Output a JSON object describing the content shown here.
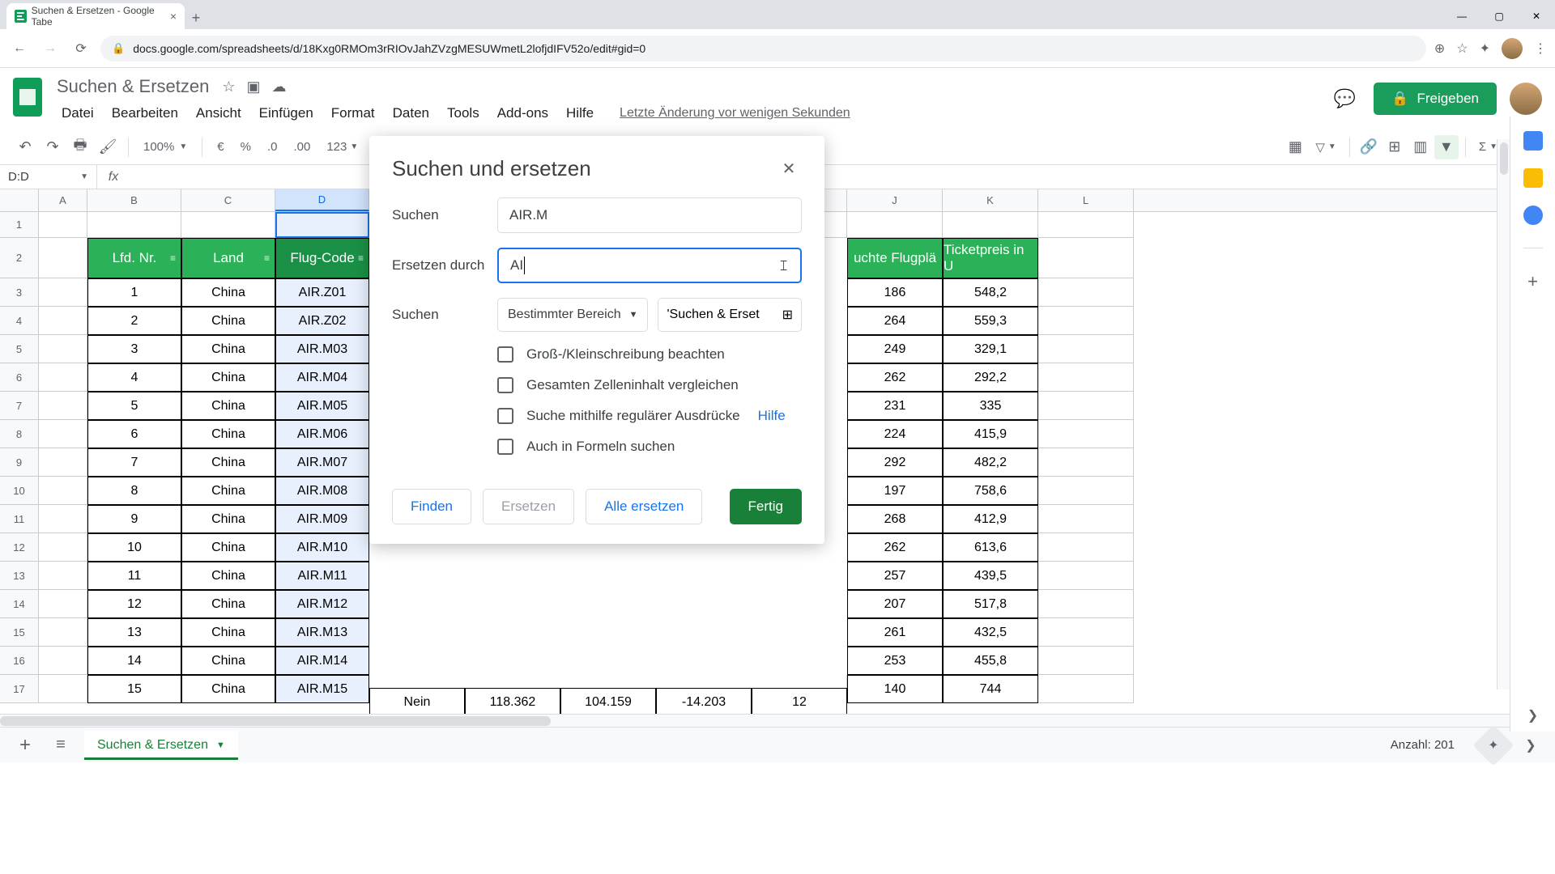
{
  "browser": {
    "tab_title": "Suchen & Ersetzen - Google Tabe",
    "url": "docs.google.com/spreadsheets/d/18Kxg0RMOm3rRIOvJahZVzgMESUWmetL2lofjdIFV52o/edit#gid=0"
  },
  "doc": {
    "title": "Suchen & Ersetzen",
    "menus": [
      "Datei",
      "Bearbeiten",
      "Ansicht",
      "Einfügen",
      "Format",
      "Daten",
      "Tools",
      "Add-ons",
      "Hilfe"
    ],
    "last_edit": "Letzte Änderung vor wenigen Sekunden",
    "share": "Freigeben"
  },
  "toolbar": {
    "zoom": "100%",
    "currency": "€",
    "percent": "%",
    "dec_dec": ".0",
    "inc_dec": ".00",
    "num_format": "123",
    "sigma": "Σ"
  },
  "formula_bar": {
    "name_box": "D:D",
    "fx": "fx"
  },
  "columns": [
    "A",
    "B",
    "C",
    "D",
    "J",
    "K",
    "L"
  ],
  "table": {
    "headers": {
      "B": "Lfd. Nr.",
      "C": "Land",
      "D": "Flug-Code",
      "J": "uchte Flugplä",
      "K": "Ticketpreis in U"
    },
    "rows": [
      {
        "n": 1,
        "B": "1",
        "C": "China",
        "D": "AIR.Z01",
        "J": "186",
        "K": "548,2"
      },
      {
        "n": 2,
        "B": "2",
        "C": "China",
        "D": "AIR.Z02",
        "J": "264",
        "K": "559,3"
      },
      {
        "n": 3,
        "B": "3",
        "C": "China",
        "D": "AIR.M03",
        "J": "249",
        "K": "329,1"
      },
      {
        "n": 4,
        "B": "4",
        "C": "China",
        "D": "AIR.M04",
        "J": "262",
        "K": "292,2"
      },
      {
        "n": 5,
        "B": "5",
        "C": "China",
        "D": "AIR.M05",
        "J": "231",
        "K": "335"
      },
      {
        "n": 6,
        "B": "6",
        "C": "China",
        "D": "AIR.M06",
        "J": "224",
        "K": "415,9"
      },
      {
        "n": 7,
        "B": "7",
        "C": "China",
        "D": "AIR.M07",
        "J": "292",
        "K": "482,2"
      },
      {
        "n": 8,
        "B": "8",
        "C": "China",
        "D": "AIR.M08",
        "J": "197",
        "K": "758,6"
      },
      {
        "n": 9,
        "B": "9",
        "C": "China",
        "D": "AIR.M09",
        "J": "268",
        "K": "412,9"
      },
      {
        "n": 10,
        "B": "10",
        "C": "China",
        "D": "AIR.M10",
        "J": "262",
        "K": "613,6"
      },
      {
        "n": 11,
        "B": "11",
        "C": "China",
        "D": "AIR.M11",
        "J": "257",
        "K": "439,5"
      },
      {
        "n": 12,
        "B": "12",
        "C": "China",
        "D": "AIR.M12",
        "J": "207",
        "K": "517,8"
      },
      {
        "n": 13,
        "B": "13",
        "C": "China",
        "D": "AIR.M13",
        "J": "261",
        "K": "432,5"
      },
      {
        "n": 14,
        "B": "14",
        "C": "China",
        "D": "AIR.M14",
        "J": "253",
        "K": "455,8"
      },
      {
        "n": 15,
        "B": "15",
        "C": "China",
        "D": "AIR.M15",
        "J": "140",
        "K": "744"
      }
    ],
    "row17_mid": [
      "Nein",
      "118.362",
      "104.159",
      "-14.203",
      "12"
    ]
  },
  "dialog": {
    "title": "Suchen und ersetzen",
    "search_label": "Suchen",
    "search_value": "AIR.M",
    "replace_label": "Ersetzen durch",
    "replace_value": "AI",
    "scope_label": "Suchen",
    "scope_value": "Bestimmter Bereich",
    "range_value": "'Suchen & Erset",
    "opt_case": "Groß-/Kleinschreibung beachten",
    "opt_entire": "Gesamten Zelleninhalt vergleichen",
    "opt_regex": "Suche mithilfe regulärer Ausdrücke",
    "opt_regex_help": "Hilfe",
    "opt_formulas": "Auch in Formeln suchen",
    "btn_find": "Finden",
    "btn_replace": "Ersetzen",
    "btn_replace_all": "Alle ersetzen",
    "btn_done": "Fertig"
  },
  "sheet_tabs": {
    "active": "Suchen & Ersetzen"
  },
  "status": {
    "count": "Anzahl: 201"
  }
}
